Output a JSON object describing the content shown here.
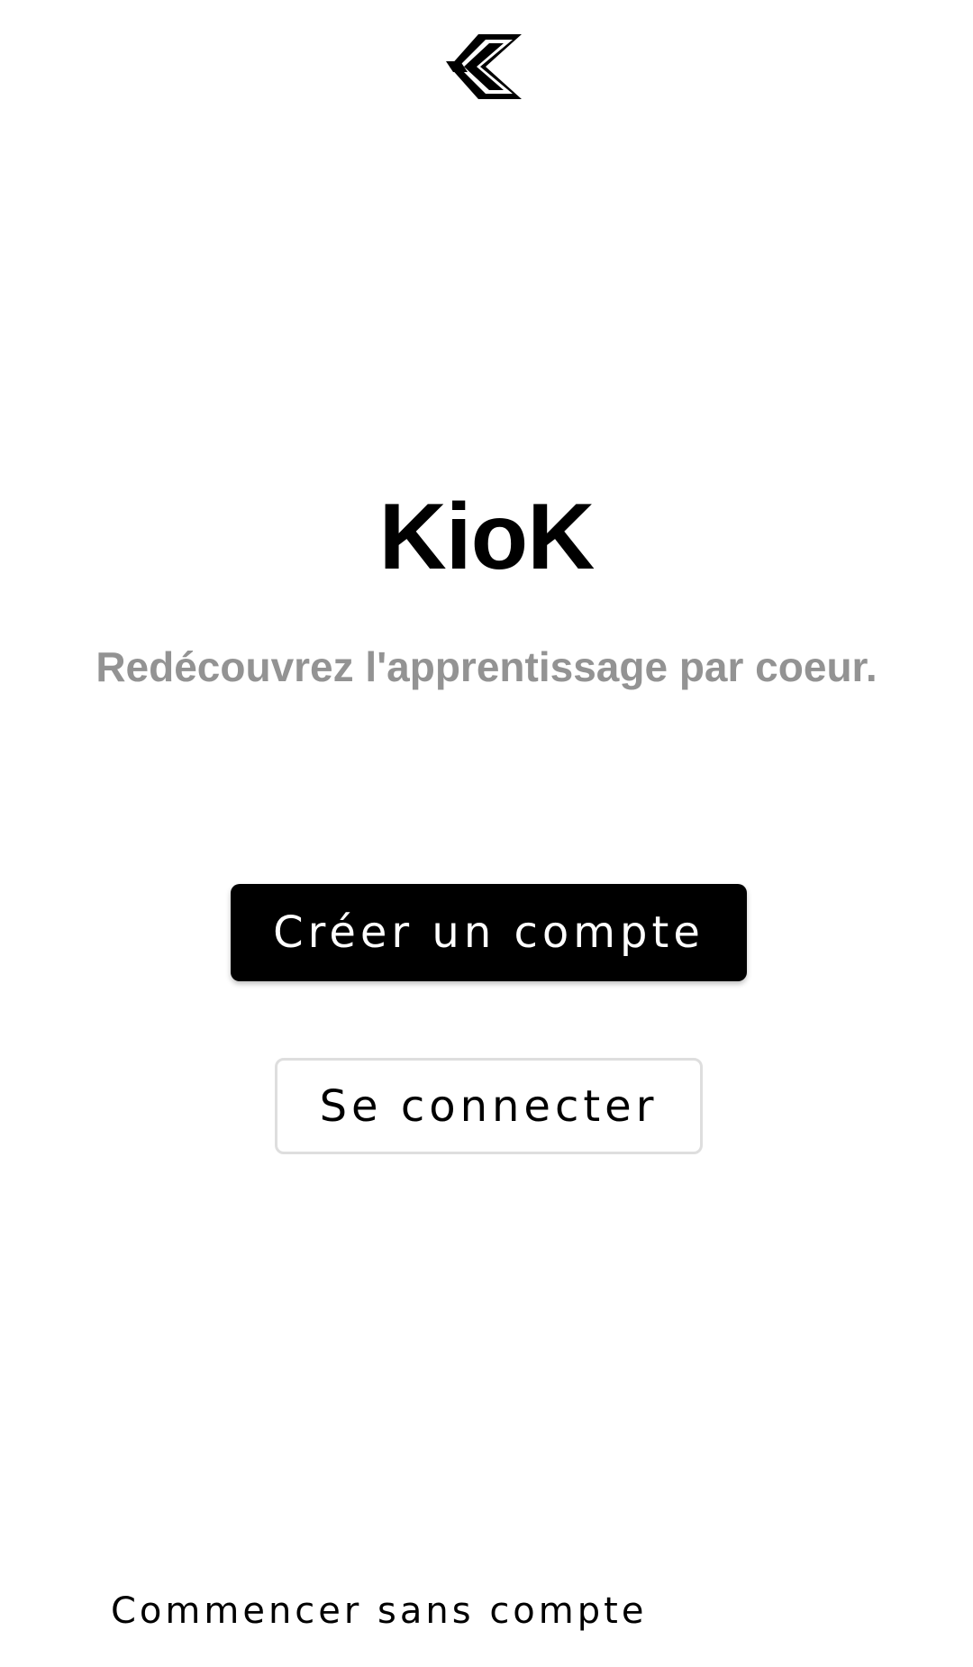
{
  "app": {
    "name": "KioK",
    "tagline": "Redécouvrez l'apprentissage par coeur.",
    "logo_icon": "kiok-chevron-logo-icon"
  },
  "actions": {
    "create_account_label": "Créer un compte",
    "sign_in_label": "Se connecter",
    "continue_without_account_label": "Commencer sans compte"
  },
  "colors": {
    "background": "#ffffff",
    "primary_button": "#000000",
    "primary_button_text": "#ffffff",
    "tagline": "#939393",
    "secondary_button_border": "#dedede"
  }
}
